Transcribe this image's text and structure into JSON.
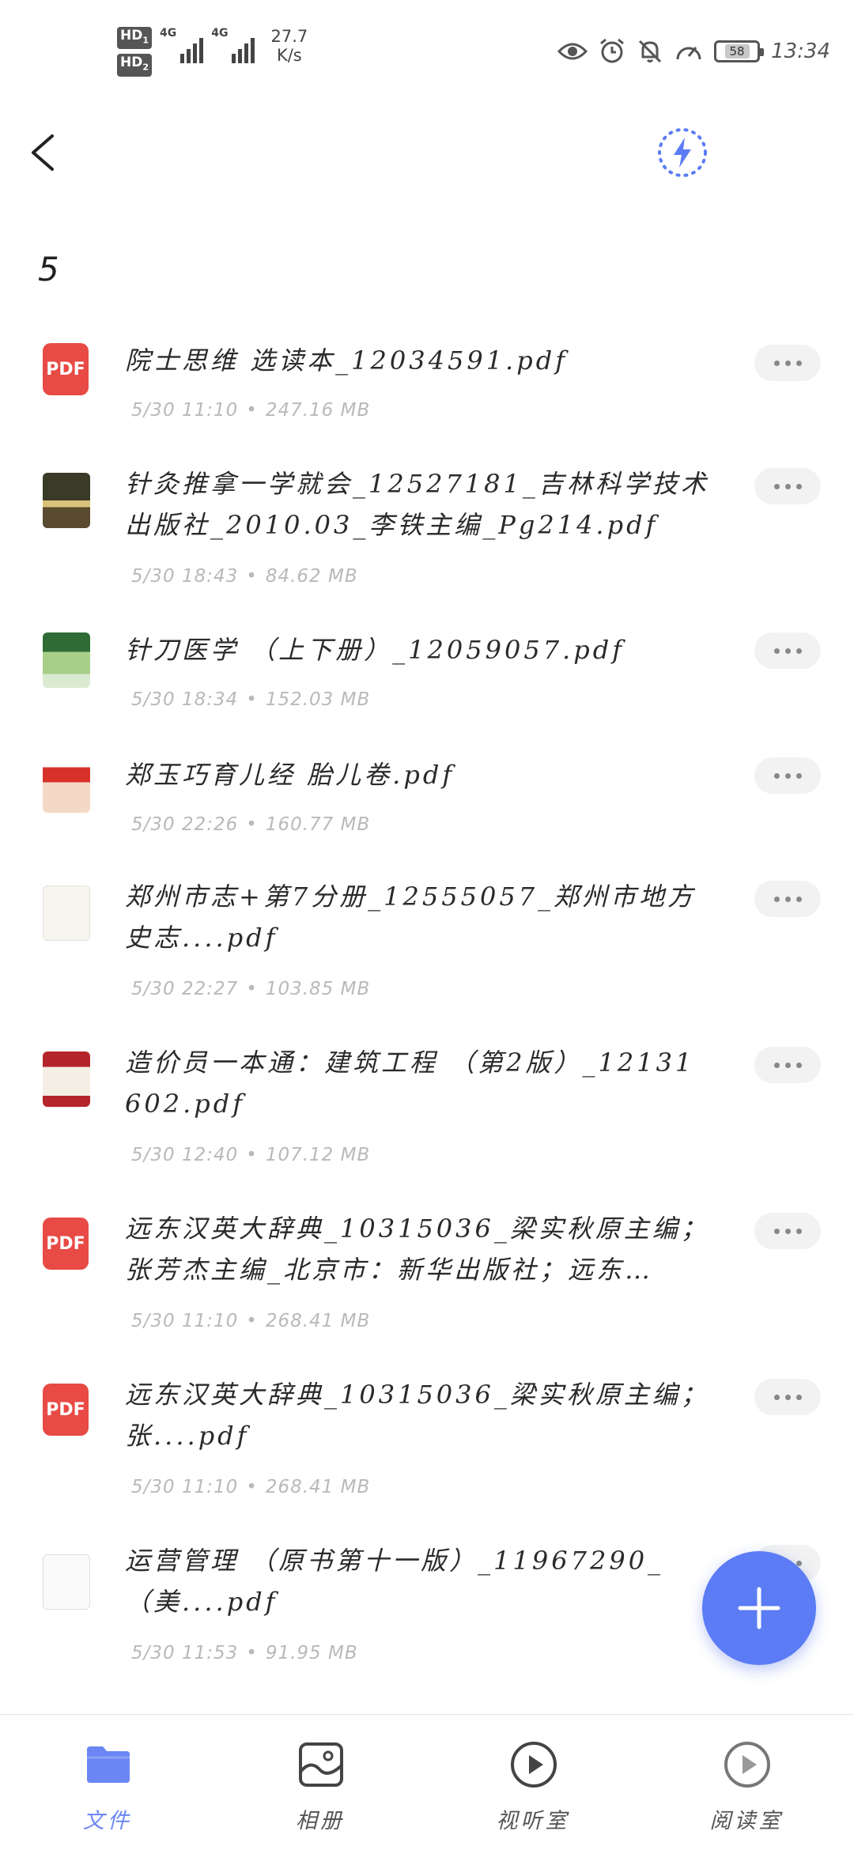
{
  "status_bar": {
    "hd1": "HD",
    "hd1_sub": "1",
    "hd2": "HD",
    "hd2_sub": "2",
    "net1": "4G",
    "net2": "4G",
    "speed_value": "27.7",
    "speed_unit": "K/s",
    "battery": "58",
    "time": "13:34"
  },
  "header": {
    "folder_title": "5"
  },
  "files": [
    {
      "name": "院士思维 选读本_12034591.pdf",
      "date": "5/30 11:10",
      "size": "247.16 MB",
      "thumb": "pdf-icon",
      "thumb_label": "PDF"
    },
    {
      "name": "针灸推拿一学就会_12527181_吉林科学技术出版社_2010.03_李铁主编_Pg214.pdf",
      "date": "5/30 18:43",
      "size": "84.62 MB",
      "thumb": "book-cover-icon",
      "thumb_label": ""
    },
    {
      "name": "针刀医学 （上下册）_12059057.pdf",
      "date": "5/30 18:34",
      "size": "152.03 MB",
      "thumb": "book-cover-icon",
      "thumb_label": ""
    },
    {
      "name": "郑玉巧育儿经 胎儿卷.pdf",
      "date": "5/30 22:26",
      "size": "160.77 MB",
      "thumb": "book-cover-icon",
      "thumb_label": ""
    },
    {
      "name": "郑州市志+第7分册_12555057_郑州市地方史志....pdf",
      "date": "5/30 22:27",
      "size": "103.85 MB",
      "thumb": "book-cover-icon",
      "thumb_label": ""
    },
    {
      "name": "造价员一本通：建筑工程 （第2版）_12131602.pdf",
      "date": "5/30 12:40",
      "size": "107.12 MB",
      "thumb": "book-cover-icon",
      "thumb_label": ""
    },
    {
      "name": "远东汉英大辞典_10315036_梁实秋原主编；张芳杰主编_北京市：新华出版社；远东…",
      "date": "5/30 11:10",
      "size": "268.41 MB",
      "thumb": "pdf-icon",
      "thumb_label": "PDF"
    },
    {
      "name": "远东汉英大辞典_10315036_梁实秋原主编；张....pdf",
      "date": "5/30 11:10",
      "size": "268.41 MB",
      "thumb": "pdf-icon",
      "thumb_label": "PDF"
    },
    {
      "name": "运营管理 （原书第十一版）_11967290_（美....pdf",
      "date": "5/30 11:53",
      "size": "91.95 MB",
      "thumb": "book-cover-icon",
      "thumb_label": ""
    }
  ],
  "bottom_nav": [
    {
      "label": "文件",
      "icon": "folder-icon",
      "active": true
    },
    {
      "label": "相册",
      "icon": "album-icon",
      "active": false
    },
    {
      "label": "视听室",
      "icon": "play-circle-icon",
      "active": false
    },
    {
      "label": "阅读室",
      "icon": "play-circle-icon",
      "active": false
    }
  ],
  "colors": {
    "accent": "#5b7cf5",
    "pdf_red": "#e84a45",
    "meta_gray": "#b9b9b9"
  }
}
